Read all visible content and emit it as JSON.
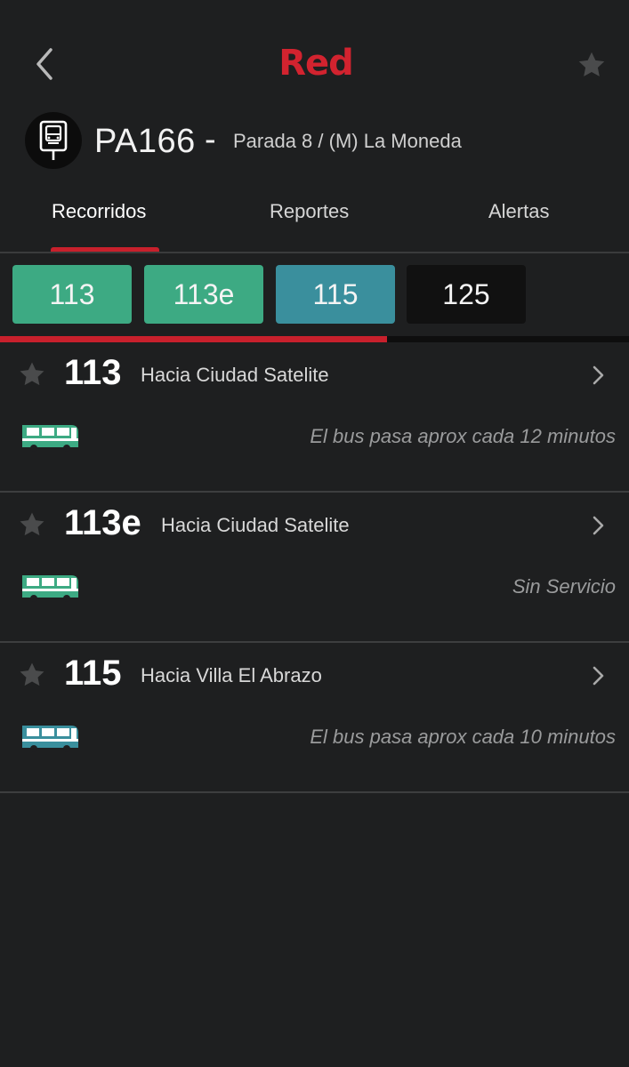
{
  "app": {
    "logo_text": "Red",
    "brand_color": "#d2232f"
  },
  "stop": {
    "code": "PA166",
    "separator": "-",
    "name": "Parada 8 / (M) La Moneda"
  },
  "tabs": [
    {
      "label": "Recorridos",
      "active": true
    },
    {
      "label": "Reportes",
      "active": false
    },
    {
      "label": "Alertas",
      "active": false
    }
  ],
  "route_chips": [
    {
      "label": "113",
      "color": "#3daa83"
    },
    {
      "label": "113e",
      "color": "#3daa83"
    },
    {
      "label": "115",
      "color": "#3a8f9d"
    },
    {
      "label": "125",
      "color": "#111111"
    }
  ],
  "scroll_progress": 0.615,
  "routes": [
    {
      "number": "113",
      "destination": "Hacia Ciudad Satelite",
      "status": "El bus pasa aprox cada 12 minutos",
      "bus_color": "#3daa83"
    },
    {
      "number": "113e",
      "destination": "Hacia Ciudad Satelite",
      "status": "Sin Servicio",
      "bus_color": "#3daa83"
    },
    {
      "number": "115",
      "destination": "Hacia Villa El Abrazo",
      "status": "El bus pasa aprox cada 10 minutos",
      "bus_color": "#3a8f9d"
    }
  ],
  "icons": {
    "back": "chevron-left-icon",
    "favorite": "star-icon",
    "stop": "bus-stop-icon",
    "row_chevron": "chevron-right-icon",
    "bus": "bus-icon"
  }
}
